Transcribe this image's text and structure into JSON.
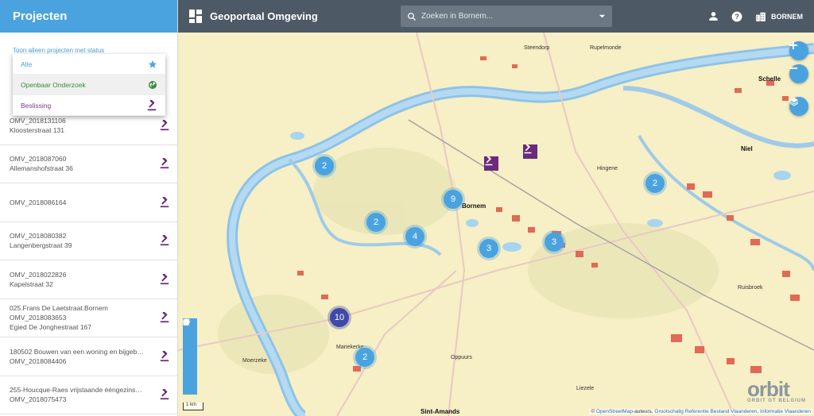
{
  "sidebar": {
    "title": "Projecten",
    "filter_label": "Toon alleen projecten met status",
    "status_options": [
      {
        "label": "Alle",
        "icon": "star-icon",
        "color": "#4aa3df"
      },
      {
        "label": "Openbaar Onderzoek",
        "icon": "globe-icon",
        "color": "#3a8a3a"
      },
      {
        "label": "Beslissing",
        "icon": "gavel-icon",
        "color": "#7a3a8a"
      }
    ],
    "projects": [
      {
        "line1": "OMV_2018131106",
        "line2": "Kloosterstraat 131",
        "line3": ""
      },
      {
        "line1": "OMV_2018087060",
        "line2": "Allemanshofstraat 36",
        "line3": ""
      },
      {
        "line1": "OMV_2018086164",
        "line2": "",
        "line3": ""
      },
      {
        "line1": "OMV_2018080382",
        "line2": "Langenbergstraat 39",
        "line3": ""
      },
      {
        "line1": "OMV_2018022826",
        "line2": "Kapelstraat 32",
        "line3": ""
      },
      {
        "line1": "025.Frans De Laetstraat.Bornem",
        "line2": "OMV_2018083653",
        "line3": "Egied De Jonghestraat 167"
      },
      {
        "line1": "180502 Bouwen van een woning en bijgebou...",
        "line2": "OMV_2018084406",
        "line3": ""
      },
      {
        "line1": "255-Houcque-Raes vrijstaande ééngezinswo...",
        "line2": "OMV_2018075473",
        "line3": ""
      }
    ]
  },
  "topbar": {
    "title": "Geoportaal Omgeving",
    "search_placeholder": "Zoeken in Bornem...",
    "municipality": "BORNEM"
  },
  "map": {
    "places": [
      {
        "name": "Steendorp",
        "big": false
      },
      {
        "name": "Rupelmonde",
        "big": false
      },
      {
        "name": "Schelle",
        "big": true
      },
      {
        "name": "Niel",
        "big": true
      },
      {
        "name": "Hingene",
        "big": false
      },
      {
        "name": "Bornem",
        "big": true
      },
      {
        "name": "Mariekerke",
        "big": false
      },
      {
        "name": "Moerzeke",
        "big": false
      },
      {
        "name": "Oppuurs",
        "big": false
      },
      {
        "name": "Liezele",
        "big": false
      },
      {
        "name": "Ruisbroek",
        "big": false
      },
      {
        "name": "Sint-Amands",
        "big": true
      }
    ],
    "clusters": [
      "2",
      "2",
      "9",
      "2",
      "4",
      "3",
      "3",
      "10",
      "2"
    ],
    "scale_label": "1 km",
    "attribution": {
      "prefix": "©",
      "osm": "OpenStreetMap",
      "mid": "-auteurs,",
      "grb": "Grootschalig Referentie Bestand Vlaanderen,",
      "iv": "Informatie Vlaanderen"
    },
    "logo_text": "orbit",
    "logo_sub": "ORBIT GT BELGIUM"
  },
  "colors": {
    "accent": "#4aa3df",
    "topbar": "#4d5a66",
    "beslissing": "#6b2a7b"
  }
}
